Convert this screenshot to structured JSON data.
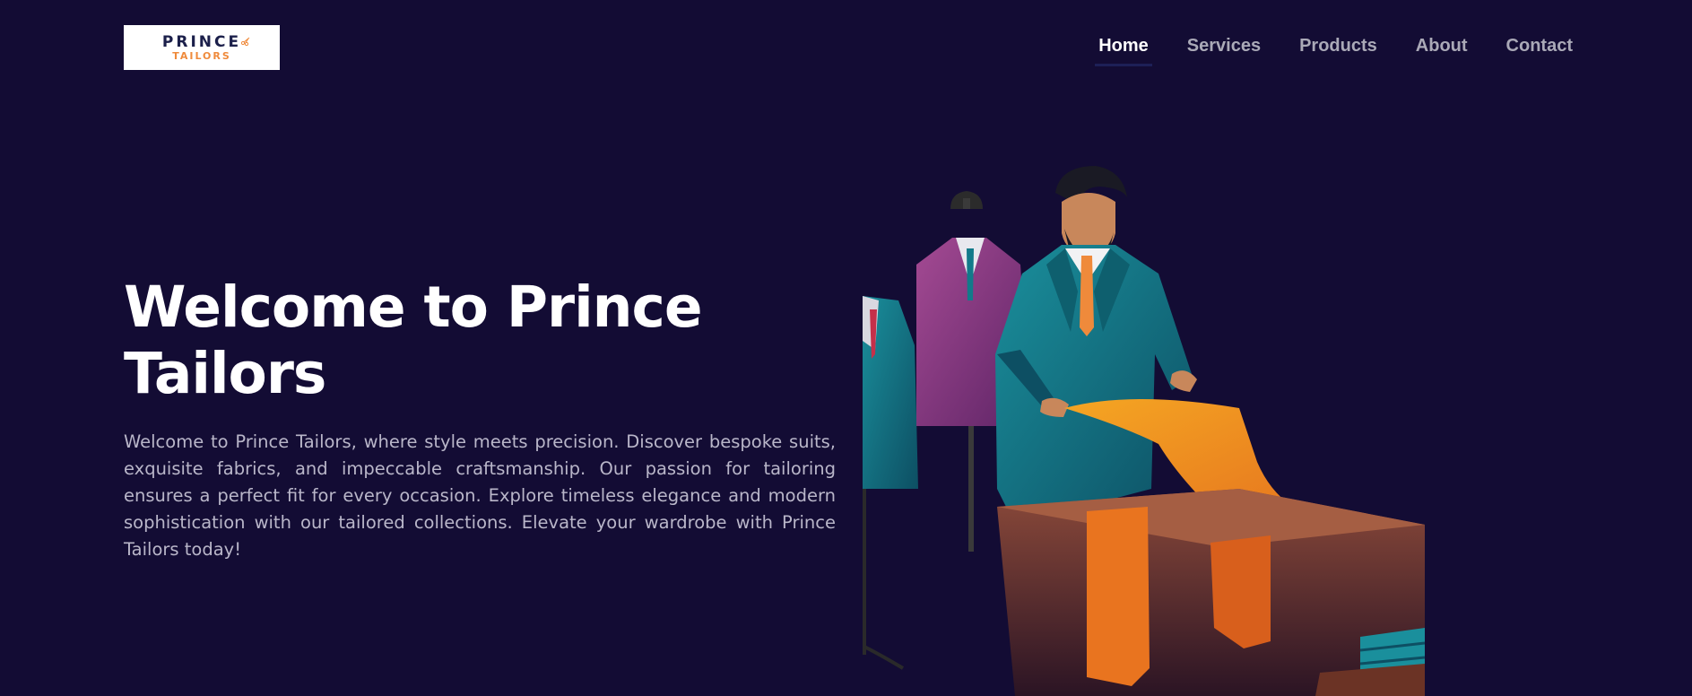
{
  "brand": {
    "logo_top": "PRINCE",
    "logo_bottom": "TAILORS"
  },
  "nav": {
    "items": [
      {
        "label": "Home",
        "active": true
      },
      {
        "label": "Services",
        "active": false
      },
      {
        "label": "Products",
        "active": false
      },
      {
        "label": "About",
        "active": false
      },
      {
        "label": "Contact",
        "active": false
      }
    ]
  },
  "hero": {
    "title": "Welcome to Prince Tailors",
    "description": "Welcome to Prince Tailors, where style meets precision. Discover bespoke suits, exquisite fabrics, and impeccable craftsmanship. Our passion for tailoring ensures a perfect fit for every occasion. Explore timeless elegance and modern sophistication with our tailored collections. Elevate your wardrobe with Prince Tailors today!"
  },
  "colors": {
    "background": "#130c34",
    "nav_active": "#ffffff",
    "nav_inactive": "#aaa9b7",
    "accent_orange": "#ef8a3b",
    "suit_teal": "#127a8a"
  },
  "icons": {
    "logo_scissors": "scissors-icon"
  }
}
